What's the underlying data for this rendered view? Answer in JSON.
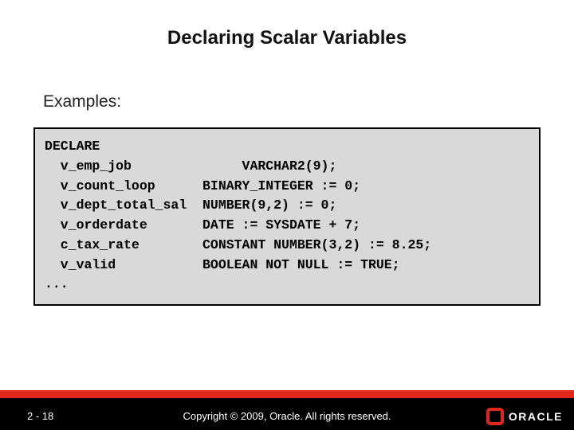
{
  "title": "Declaring Scalar Variables",
  "subheading": "Examples:",
  "code": {
    "l1": "DECLARE",
    "l2": "  v_emp_job              VARCHAR2(9);",
    "l3": "  v_count_loop      BINARY_INTEGER := 0;",
    "l4": "  v_dept_total_sal  NUMBER(9,2) := 0;",
    "l5": "  v_orderdate       DATE := SYSDATE + 7;",
    "l6": "  c_tax_rate        CONSTANT NUMBER(3,2) := 8.25;",
    "l7": "  v_valid           BOOLEAN NOT NULL := TRUE;",
    "l8": "..."
  },
  "footer": {
    "page": "2 - 18",
    "copyright": "Copyright © 2009, Oracle. All rights reserved.",
    "brand": "ORACLE"
  }
}
